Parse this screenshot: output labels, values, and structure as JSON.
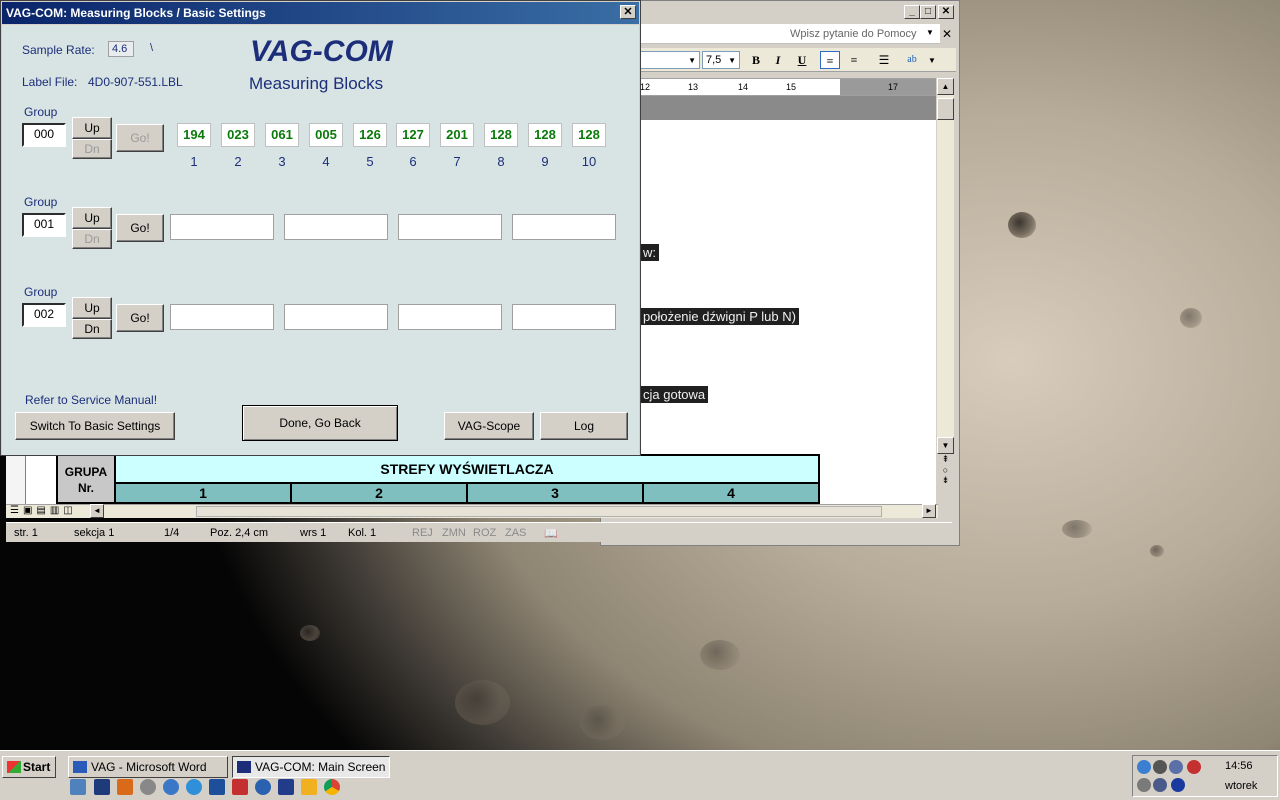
{
  "vag_window": {
    "title": "VAG-COM: Measuring Blocks / Basic Settings",
    "close_glyph": "✕",
    "sample_rate_label": "Sample Rate:",
    "sample_rate_value": "4.6",
    "label_file_label": "Label File:",
    "label_file_value": "4D0-907-551.LBL",
    "brand": "VAG-COM",
    "subtitle": "Measuring Blocks",
    "groups": [
      {
        "label": "Group",
        "number": "000",
        "up": "Up",
        "dn": "Dn",
        "go": "Go!"
      },
      {
        "label": "Group",
        "number": "001",
        "up": "Up",
        "dn": "Dn",
        "go": "Go!"
      },
      {
        "label": "Group",
        "number": "002",
        "up": "Up",
        "dn": "Dn",
        "go": "Go!"
      }
    ],
    "group0_values": [
      "194",
      "023",
      "061",
      "005",
      "126",
      "127",
      "201",
      "128",
      "128",
      "128"
    ],
    "group0_indices": [
      "1",
      "2",
      "3",
      "4",
      "5",
      "6",
      "7",
      "8",
      "9",
      "10"
    ],
    "refer_text": "Refer to Service Manual!",
    "switch_button": "Switch To Basic Settings",
    "done_button": "Done, Go Back",
    "scope_button": "VAG-Scope",
    "log_button": "Log"
  },
  "word_window": {
    "help_placeholder": "Wpisz pytanie do Pomocy",
    "font_size": "7,5",
    "bold": "B",
    "italic": "I",
    "underline": "U",
    "ruler_marks": [
      "12",
      "13",
      "14",
      "15",
      "17"
    ],
    "selected_lines": [
      "w:",
      "położenie dźwigni P lub N)",
      "cja gotowa"
    ],
    "table_header_left": "GRUPA Nr.",
    "table_header_main": "STREFY WYŚWIETLACZA",
    "table_columns": [
      "1",
      "2",
      "3",
      "4"
    ],
    "status": {
      "page": "str. 1",
      "section": "sekcja 1",
      "pages": "1/4",
      "position": "Poz. 2,4 cm",
      "line": "wrs 1",
      "column": "Kol. 1",
      "rej": "REJ",
      "zmn": "ZMN",
      "roz": "ROZ",
      "zas": "ZAS"
    }
  },
  "taskbar": {
    "start": "Start",
    "tasks": [
      "VAG - Microsoft Word",
      "VAG-COM: Main Screen"
    ],
    "time": "14:56",
    "day": "wtorek"
  }
}
